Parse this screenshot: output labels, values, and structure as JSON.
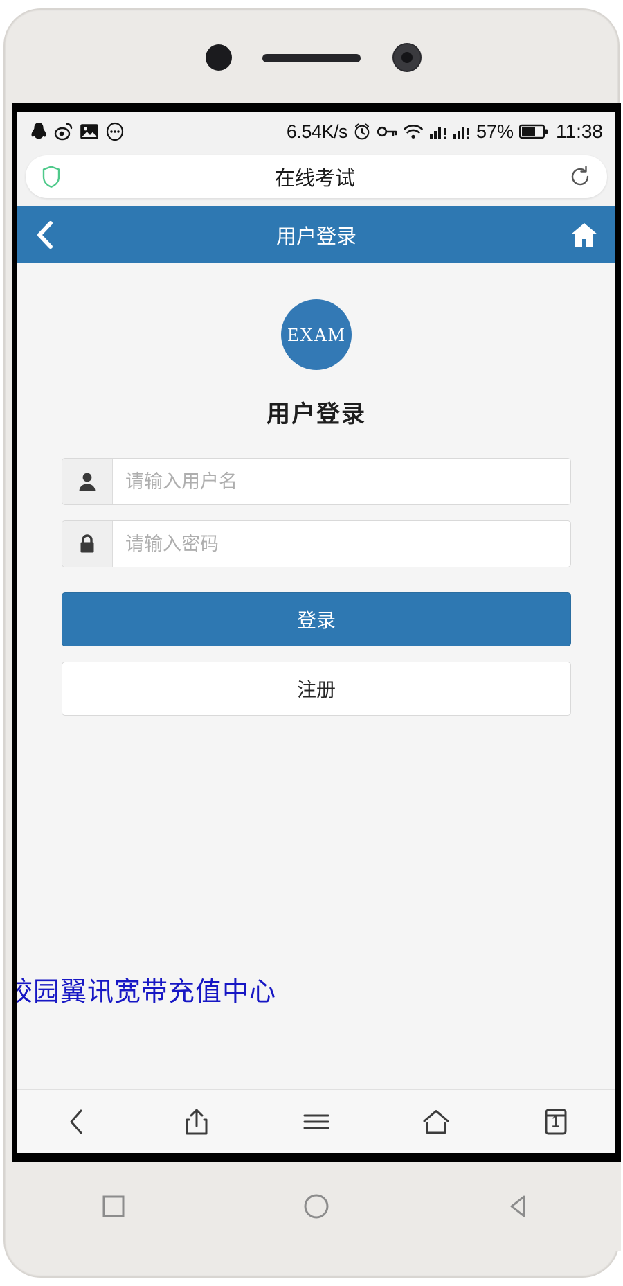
{
  "status_bar": {
    "left_icons": [
      "qq-icon",
      "weibo-icon",
      "image-icon",
      "more-dots-icon"
    ],
    "network_speed": "6.54K/s",
    "right_icons": [
      "alarm-icon",
      "vpn-key-icon",
      "wifi-icon",
      "signal-1-icon",
      "signal-2-icon"
    ],
    "battery_percent": "57%",
    "time": "11:38"
  },
  "browser": {
    "url_title": "在线考试",
    "shield_icon": "shield-icon",
    "refresh_icon": "refresh-icon",
    "toolbar": {
      "back_label": "back-icon",
      "share_label": "share-icon",
      "menu_label": "menu-icon",
      "home_label": "home-icon",
      "tabs_count": "1"
    }
  },
  "page": {
    "navbar": {
      "back_icon": "chevron-left-icon",
      "title": "用户登录",
      "home_icon": "home-icon"
    },
    "logo_text": "EXAM",
    "heading": "用户登录",
    "fields": [
      {
        "name": "username",
        "icon": "user-icon",
        "placeholder": "请输入用户名",
        "value": ""
      },
      {
        "name": "password",
        "icon": "lock-icon",
        "placeholder": "请输入密码",
        "value": ""
      }
    ],
    "login_button": "登录",
    "register_button": "注册",
    "watermark": "校园翼讯宽带充值中心"
  },
  "android_nav": {
    "recent": "square-icon",
    "home": "circle-icon",
    "back": "triangle-icon"
  },
  "colors": {
    "primary_blue": "#2e78b2",
    "logo_blue": "#3379b5",
    "watermark_blue": "#1717c4",
    "shield_green": "#4ec98a",
    "page_bg": "#f5f5f5"
  }
}
